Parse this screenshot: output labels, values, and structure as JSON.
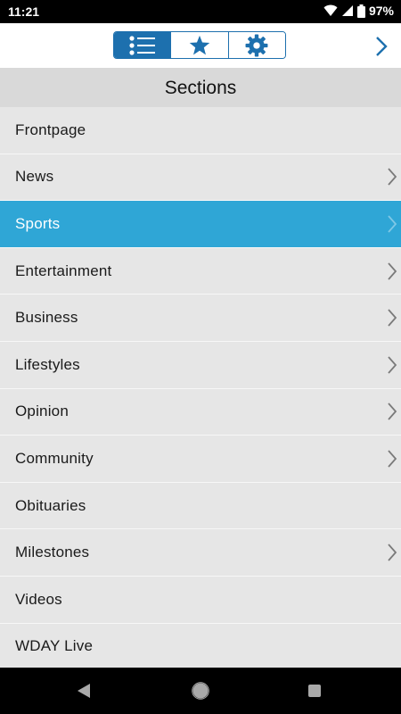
{
  "status_bar": {
    "time": "11:21",
    "battery": "97%"
  },
  "toolbar": {
    "segments": [
      {
        "icon": "list-icon",
        "active": true
      },
      {
        "icon": "star-icon",
        "active": false
      },
      {
        "icon": "gear-icon",
        "active": false
      }
    ],
    "forward_icon": "chevron-right-icon"
  },
  "header": {
    "title": "Sections"
  },
  "sections": [
    {
      "label": "Frontpage",
      "has_children": false,
      "selected": false
    },
    {
      "label": "News",
      "has_children": true,
      "selected": false
    },
    {
      "label": "Sports",
      "has_children": true,
      "selected": true
    },
    {
      "label": "Entertainment",
      "has_children": true,
      "selected": false
    },
    {
      "label": "Business",
      "has_children": true,
      "selected": false
    },
    {
      "label": "Lifestyles",
      "has_children": true,
      "selected": false
    },
    {
      "label": "Opinion",
      "has_children": true,
      "selected": false
    },
    {
      "label": "Community",
      "has_children": true,
      "selected": false
    },
    {
      "label": "Obituaries",
      "has_children": false,
      "selected": false
    },
    {
      "label": "Milestones",
      "has_children": true,
      "selected": false
    },
    {
      "label": "Videos",
      "has_children": false,
      "selected": false
    },
    {
      "label": "WDAY Live",
      "has_children": false,
      "selected": false
    }
  ],
  "colors": {
    "accent": "#1d70ae",
    "selected": "#2fa6d6",
    "list_bg": "#e6e6e6"
  }
}
